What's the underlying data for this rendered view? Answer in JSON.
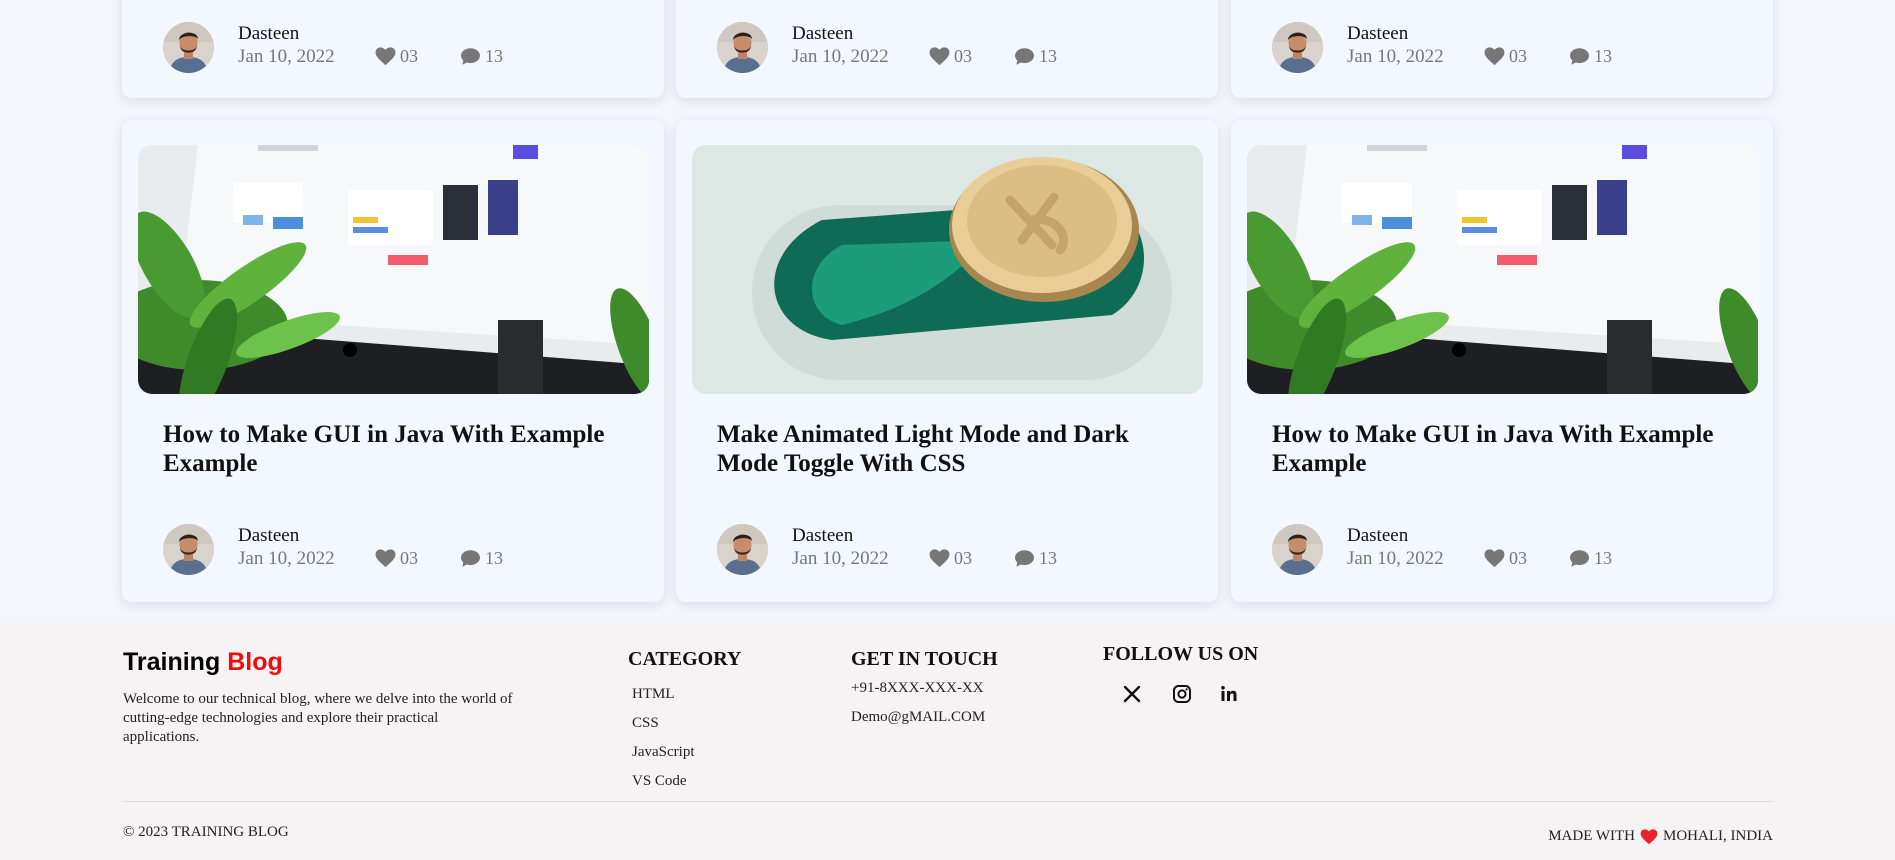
{
  "top_cards": [
    {
      "author": "Dasteen",
      "date": "Jan 10, 2022",
      "likes": "03",
      "comments": "13"
    },
    {
      "author": "Dasteen",
      "date": "Jan 10, 2022",
      "likes": "03",
      "comments": "13"
    },
    {
      "author": "Dasteen",
      "date": "Jan 10, 2022",
      "likes": "03",
      "comments": "13"
    }
  ],
  "posts": [
    {
      "title": "How to Make GUI in Java With Example Example",
      "image": "monitor-with-plants",
      "author": "Dasteen",
      "date": "Jan 10, 2022",
      "likes": "03",
      "comments": "13"
    },
    {
      "title": "Make Animated Light Mode and Dark Mode Toggle With CSS",
      "image": "coin-toggle",
      "author": "Dasteen",
      "date": "Jan 10, 2022",
      "likes": "03",
      "comments": "13"
    },
    {
      "title": "How to Make GUI in Java With Example Example",
      "image": "monitor-with-plants",
      "author": "Dasteen",
      "date": "Jan 10, 2022",
      "likes": "03",
      "comments": "13"
    }
  ],
  "footer": {
    "brand_part1": "Training",
    "brand_part2": "Blog",
    "brand_accent_color": "#f10d0d",
    "about": "Welcome to our technical blog, where we delve into the world of cutting-edge technologies and explore their practical applications.",
    "category_title": "CATEGORY",
    "categories": [
      "HTML",
      "CSS",
      "JavaScript",
      "VS Code"
    ],
    "contact_title": "GET IN TOUCH",
    "phone": "+91-8XXX-XXX-XX",
    "email": "Demo@gMAIL.COM",
    "follow_title": "FOLLOW US ON",
    "social_icons": [
      "x-icon",
      "instagram-icon",
      "linkedin-icon"
    ],
    "copyright": "© 2023 TRAINING BLOG",
    "made_with_prefix": "MADE WITH",
    "made_with_suffix": "MOHALI, INDIA"
  }
}
